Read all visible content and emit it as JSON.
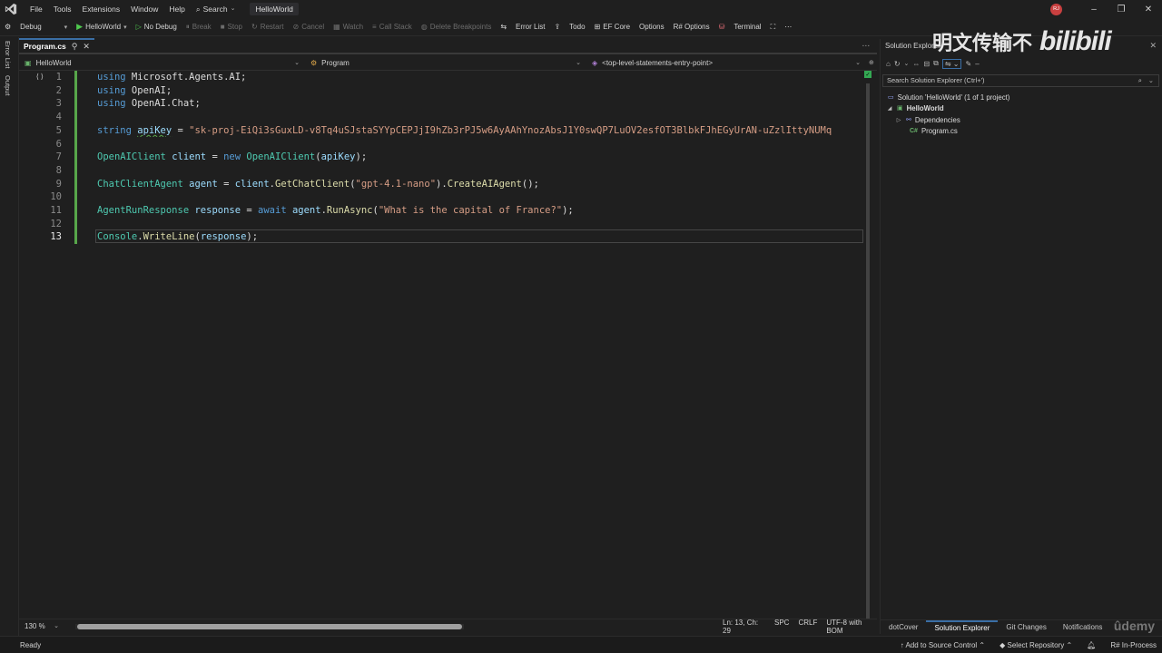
{
  "menu": {
    "items": [
      "File",
      "Tools",
      "Extensions",
      "Window",
      "Help"
    ],
    "search_label": "Search",
    "solution_name": "HelloWorld",
    "avatar_initials": "RJ"
  },
  "toolbar": {
    "config": "Debug",
    "start_target": "HelloWorld",
    "no_debug": "No Debug",
    "break": "Break",
    "stop": "Stop",
    "restart": "Restart",
    "cancel": "Cancel",
    "watch": "Watch",
    "call_stack": "Call Stack",
    "delete_breakpoints": "Delete Breakpoints",
    "error_list": "Error List",
    "todo": "Todo",
    "ef_core": "EF Core",
    "options": "Options",
    "r_options": "R# Options",
    "terminal": "Terminal"
  },
  "left_strip": {
    "error_list": "Error List",
    "output": "Output"
  },
  "editor": {
    "tab_label": "Program.cs",
    "nav_project": "HelloWorld",
    "nav_type": "Program",
    "nav_member": "<top-level-statements-entry-point>",
    "line_numbers": [
      "1",
      "2",
      "3",
      "4",
      "5",
      "6",
      "7",
      "8",
      "9",
      "10",
      "11",
      "12",
      "13"
    ],
    "active_line": 13,
    "zoom": "130 %",
    "caret": "Ln: 13, Ch: 29",
    "whitespace": "SPC",
    "line_endings": "CRLF",
    "encoding": "UTF-8 with BOM",
    "code": {
      "l1_kw": "using",
      "l1_ns": " Microsoft.Agents.AI;",
      "l2_kw": "using",
      "l2_ns": " OpenAI;",
      "l3_kw": "using",
      "l3_ns": " OpenAI.Chat;",
      "l5_kw": "string",
      "l5_var": "apiKey",
      "l5_eq": " = ",
      "l5_str": "\"sk-proj-EiQi3sGuxLD-v8Tq4uSJstaSYYpCEPJjI9hZb3rPJ5w6AyAAhYnozAbsJ1Y0swQP7LuOV2esfOT3BlbkFJhEGyUrAN-uZzlIttyNUMq",
      "l7_type": "OpenAIClient",
      "l7_var": "client",
      "l7_eq": " = ",
      "l7_new": "new",
      "l7_type2": "OpenAIClient",
      "l7_arg": "apiKey",
      "l7_end": ");",
      "l9_type": "ChatClientAgent",
      "l9_var": "agent",
      "l9_eq": " = ",
      "l9_obj": "client",
      "l9_m1": "GetChatClient",
      "l9_str": "\"gpt-4.1-nano\"",
      "l9_m2": "CreateAIAgent",
      "l9_end": "();",
      "l11_type": "AgentRunResponse",
      "l11_var": "response",
      "l11_eq": " = ",
      "l11_await": "await",
      "l11_obj": "agent",
      "l11_m": "RunAsync",
      "l11_str": "\"What is the capital of France?\"",
      "l11_end": ");",
      "l13_type": "Console",
      "l13_m": "WriteLine",
      "l13_arg": "response",
      "l13_end": ");"
    }
  },
  "solution_explorer": {
    "title": "Solution Explorer",
    "search_placeholder": "Search Solution Explorer (Ctrl+')",
    "solution_label": "Solution 'HelloWorld' (1 of 1 project)",
    "project": "HelloWorld",
    "dependencies": "Dependencies",
    "file": "Program.cs",
    "watermark_cn": "明文传输不",
    "watermark_bili": "bilibili",
    "bottom_tabs": [
      "dotCover",
      "Solution Explorer",
      "Git Changes",
      "Notifications"
    ]
  },
  "statusbar": {
    "left": "Ready",
    "add_source": "Add to Source Control",
    "select_repo": "Select Repository",
    "resharper": "R# In-Process",
    "udemy": "ûdemy"
  }
}
